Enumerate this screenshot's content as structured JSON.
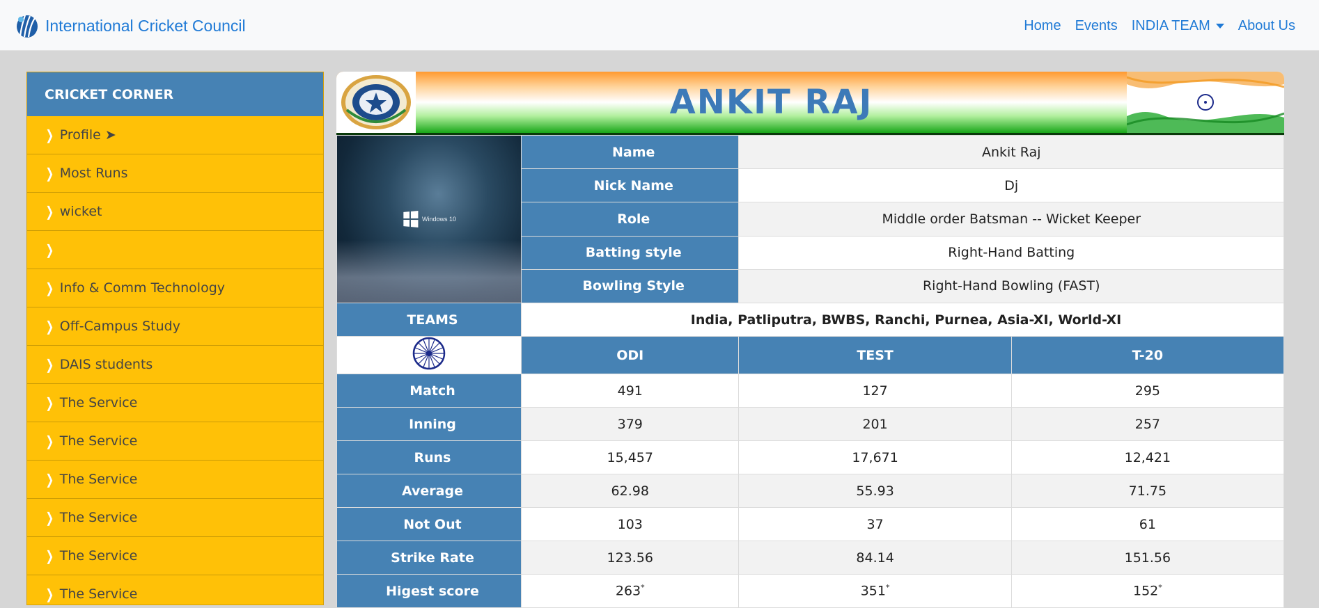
{
  "brand": {
    "name": "International Cricket Council"
  },
  "nav": {
    "home": "Home",
    "events": "Events",
    "india_team": "INDIA TEAM",
    "about": "About Us"
  },
  "sidebar": {
    "title": "CRICKET CORNER",
    "items": [
      {
        "label": "Profile ➤"
      },
      {
        "label": "Most Runs"
      },
      {
        "label": "wicket"
      },
      {
        "label": ""
      },
      {
        "label": "Info & Comm Technology"
      },
      {
        "label": "Off-Campus Study"
      },
      {
        "label": "DAIS students"
      },
      {
        "label": "The Service"
      },
      {
        "label": "The Service"
      },
      {
        "label": "The Service"
      },
      {
        "label": "The Service"
      },
      {
        "label": "The Service"
      },
      {
        "label": "The Service"
      }
    ]
  },
  "player": {
    "banner_name": "ANKIT RAJ",
    "photo_caption": "Windows 10",
    "details": [
      {
        "label": "Name",
        "value": "Ankit Raj"
      },
      {
        "label": "Nick Name",
        "value": "Dj"
      },
      {
        "label": "Role",
        "value": "Middle order Batsman -- Wicket Keeper"
      },
      {
        "label": "Batting style",
        "value": "Right-Hand Batting"
      },
      {
        "label": "Bowling Style",
        "value": "Right-Hand Bowling (FAST)"
      }
    ],
    "teams_label": "TEAMS",
    "teams": "India, Patliputra, BWBS, Ranchi, Purnea, Asia-XI, World-XI"
  },
  "stats": {
    "columns": [
      "ODI",
      "TEST",
      "T-20"
    ],
    "rows": [
      {
        "label": "Match",
        "values": [
          "491",
          "127",
          "295"
        ]
      },
      {
        "label": "Inning",
        "values": [
          "379",
          "201",
          "257"
        ]
      },
      {
        "label": "Runs",
        "values": [
          "15,457",
          "17,671",
          "12,421"
        ]
      },
      {
        "label": "Average",
        "values": [
          "62.98",
          "55.93",
          "71.75"
        ]
      },
      {
        "label": "Not Out",
        "values": [
          "103",
          "37",
          "61"
        ]
      },
      {
        "label": "Strike Rate",
        "values": [
          "123.56",
          "84.14",
          "151.56"
        ]
      },
      {
        "label": "Higest score",
        "values": [
          "263",
          "351",
          "152"
        ],
        "marks": [
          "*",
          "*",
          "*"
        ]
      }
    ]
  },
  "colors": {
    "accent": "#4682b4",
    "sidebar": "#ffc107",
    "link": "#1f7ad6"
  }
}
